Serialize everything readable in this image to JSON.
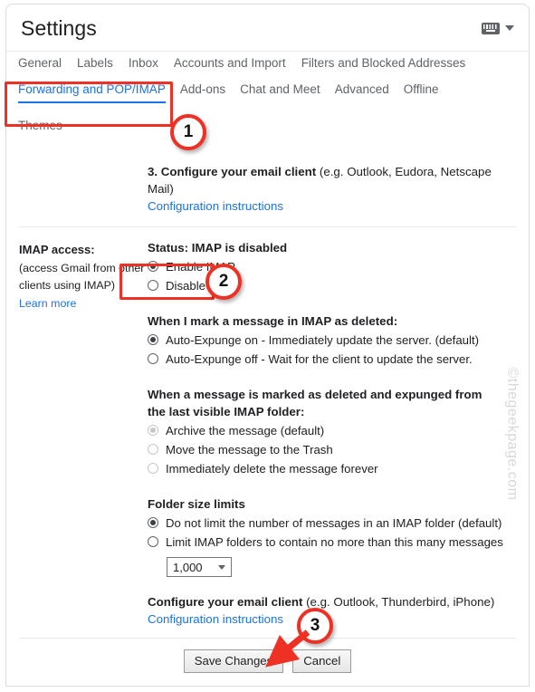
{
  "window": {
    "title": "Settings",
    "keyboard_icon": "keyboard-icon",
    "caret_icon": "chevron-down-icon"
  },
  "tabs": {
    "row1": [
      "General",
      "Labels",
      "Inbox",
      "Accounts and Import",
      "Filters and Blocked Addresses"
    ],
    "row2": [
      "Forwarding and POP/IMAP",
      "Add-ons",
      "Chat and Meet",
      "Advanced",
      "Offline"
    ],
    "row3": [
      "Themes"
    ],
    "active": "Forwarding and POP/IMAP"
  },
  "pop_section": {
    "heading_strong": "3. Configure your email client",
    "heading_rest": " (e.g. Outlook, Eudora, Netscape Mail)",
    "link": "Configuration instructions"
  },
  "imap_section": {
    "left_label": "IMAP access:",
    "left_note": "(access Gmail from other clients using IMAP)",
    "left_link": "Learn more",
    "status": "Status: IMAP is disabled",
    "options": [
      {
        "label": "Enable IMAP",
        "checked": true
      },
      {
        "label": "Disable IMAP",
        "checked": false
      }
    ]
  },
  "expunge_section": {
    "title": "When I mark a message in IMAP as deleted:",
    "options": [
      {
        "label": "Auto-Expunge on - Immediately update the server. (default)",
        "checked": true
      },
      {
        "label": "Auto-Expunge off - Wait for the client to update the server.",
        "checked": false
      }
    ]
  },
  "deleted_section": {
    "title": "When a message is marked as deleted and expunged from the last visible IMAP folder:",
    "disabled": true,
    "options": [
      {
        "label": "Archive the message (default)",
        "checked": true
      },
      {
        "label": "Move the message to the Trash",
        "checked": false
      },
      {
        "label": "Immediately delete the message forever",
        "checked": false
      }
    ]
  },
  "folder_limits": {
    "title": "Folder size limits",
    "options": [
      {
        "label": "Do not limit the number of messages in an IMAP folder (default)",
        "checked": true
      },
      {
        "label": "Limit IMAP folders to contain no more than this many messages",
        "checked": false
      }
    ],
    "select_value": "1,000"
  },
  "client_section": {
    "heading_strong": "Configure your email client",
    "heading_rest": " (e.g. Outlook, Thunderbird, iPhone)",
    "link": "Configuration instructions"
  },
  "footer": {
    "save_label": "Save Changes",
    "cancel_label": "Cancel"
  },
  "annotations": {
    "badge1": "1",
    "badge2": "2",
    "badge3": "3"
  },
  "watermark": "©thegeekpage.com",
  "colors": {
    "accent_blue": "#1a73e8",
    "annotation_red": "#ee3124",
    "text": "#202124",
    "muted": "#5f6368"
  }
}
